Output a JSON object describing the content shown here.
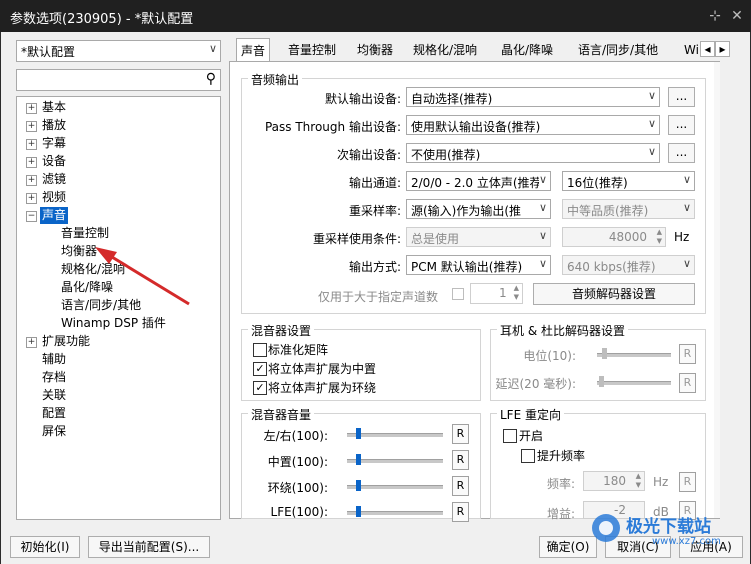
{
  "window": {
    "title": "参数选项(230905) - *默认配置"
  },
  "profile_select": {
    "value": "*默认配置"
  },
  "search": {
    "value": ""
  },
  "tree": {
    "items": [
      "基本",
      "播放",
      "字幕",
      "设备",
      "滤镜",
      "视频",
      "声音",
      "音量控制",
      "均衡器",
      "规格化/混响",
      "晶化/降噪",
      "语言/同步/其他",
      "Winamp DSP 插件",
      "扩展功能",
      "辅助",
      "存档",
      "关联",
      "配置",
      "屏保"
    ]
  },
  "tabs": [
    "声音",
    "音量控制",
    "均衡器",
    "规格化/混响",
    "晶化/降噪",
    "语言/同步/其他",
    "Wi"
  ],
  "audio_output": {
    "group_title": "音频输出",
    "default_device_label": "默认输出设备:",
    "default_device_value": "自动选择(推荐)",
    "passthrough_label": "Pass Through 输出设备:",
    "passthrough_value": "使用默认输出设备(推荐)",
    "secondary_label": "次输出设备:",
    "secondary_value": "不使用(推荐)",
    "more_label": "...",
    "channel_label": "输出通道:",
    "channel_value": "2/0/0 - 2.0 立体声(推荐",
    "bit_value": "16位(推荐)",
    "resample_label": "重采样率:",
    "resample_value": "源(输入)作为输出(推",
    "quality_value": "中等品质(推荐)",
    "resample_cond_label": "重采样使用条件:",
    "resample_cond_value": "总是使用",
    "rate_value": "48000",
    "rate_unit": "Hz",
    "output_mode_label": "输出方式:",
    "output_mode_value": "PCM 默认输出(推荐)",
    "bitrate_value": "640 kbps(推荐)",
    "only_above_label": "仅用于大于指定声道数",
    "channels_value": "1",
    "decoder_btn": "音频解码器设置"
  },
  "mixer": {
    "title": "混音器设置",
    "normalize": "标准化矩阵",
    "stereo_center": "将立体声扩展为中置",
    "stereo_surround": "将立体声扩展为环绕"
  },
  "headphone": {
    "title": "耳机 & 杜比解码器设置",
    "level_label": "电位(10):",
    "delay_label": "延迟(20 毫秒):",
    "reset": "R"
  },
  "mixer_volume": {
    "title": "混音器音量",
    "rows": [
      {
        "label": "左/右(100):",
        "level": 0.12
      },
      {
        "label": "中置(100):",
        "level": 0.12
      },
      {
        "label": "环绕(100):",
        "level": 0.12
      },
      {
        "label": "LFE(100):",
        "level": 0.12
      }
    ],
    "reset": "R"
  },
  "lfe": {
    "title": "LFE 重定向",
    "enable": "开启",
    "boost": "提升频率",
    "freq_label": "频率:",
    "freq_value": "180",
    "freq_unit": "Hz",
    "gain_label": "增益:",
    "gain_value": "-2",
    "gain_unit": "dB"
  },
  "footer": {
    "init_btn": "初始化(I)",
    "export_btn": "导出当前配置(S)...",
    "ok_btn": "确定(O)",
    "cancel_btn": "取消(C)",
    "apply_btn": "应用(A)"
  },
  "watermark": {
    "text": "极光下载站",
    "url": "www.xz7.com"
  }
}
